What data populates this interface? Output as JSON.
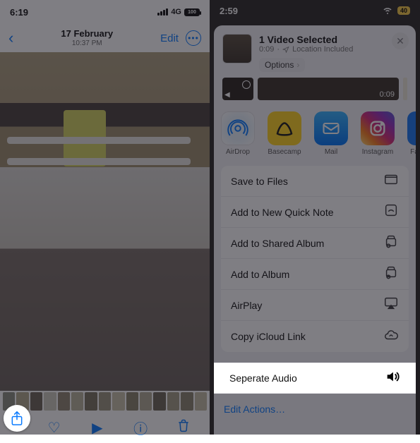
{
  "left": {
    "status": {
      "time": "6:19",
      "network": "4G",
      "battery": "100"
    },
    "nav": {
      "date": "17 February",
      "time": "10:37 PM",
      "edit": "Edit"
    },
    "toolbar": {
      "share": "Share",
      "like": "Like",
      "play": "Play",
      "info": "Info",
      "trash": "Delete"
    }
  },
  "right": {
    "status": {
      "time": "2:59",
      "battery": "40"
    },
    "sheet": {
      "title": "1 Video Selected",
      "subtitle_duration": "0:09",
      "subtitle_location": "Location Included",
      "options": "Options",
      "video_small_time": "0",
      "video_big_time": "0:09"
    },
    "apps": [
      {
        "label": "AirDrop"
      },
      {
        "label": "Basecamp"
      },
      {
        "label": "Mail"
      },
      {
        "label": "Instagram"
      },
      {
        "label": "Fa"
      }
    ],
    "actions": [
      {
        "label": "Save to Files",
        "icon": "folder"
      },
      {
        "label": "Add to New Quick Note",
        "icon": "note"
      },
      {
        "label": "Add to Shared Album",
        "icon": "shared-album"
      },
      {
        "label": "Add to Album",
        "icon": "album"
      },
      {
        "label": "AirPlay",
        "icon": "airplay"
      },
      {
        "label": "Copy iCloud Link",
        "icon": "cloud-link"
      }
    ],
    "highlight_action": {
      "label": "Seperate Audio",
      "icon": "speaker"
    },
    "edit_actions": "Edit Actions…"
  }
}
